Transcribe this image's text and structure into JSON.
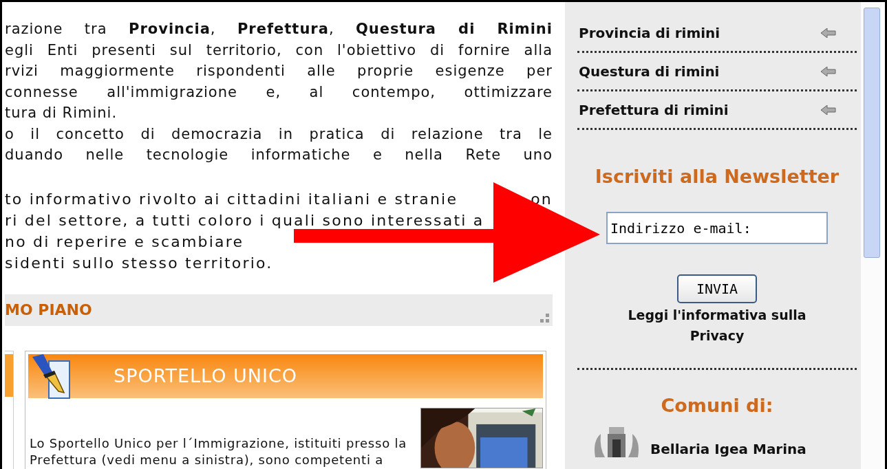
{
  "article": {
    "lines": [
      {
        "text": "razione tra **Provincia**, **Prefettura**, **Questura di Rimini**",
        "full": true
      },
      {
        "text": "egli Enti presenti sul territorio, con l'obiettivo di fornire alla",
        "full": true
      },
      {
        "text": "rvizi maggiormente rispondenti alle proprie esigenze per",
        "full": true
      },
      {
        "text": "connesse all'immigrazione e, al contempo, ottimizzare",
        "full": true
      },
      {
        "text": "tura di Rimini.",
        "full": false
      },
      {
        "text": "o il concetto di democrazia in pratica di relazione tra le",
        "full": true
      },
      {
        "text": "duando nelle tecnologie informatiche e nella Rete uno",
        "full": true
      }
    ],
    "lines_2": [
      {
        "text": "to informativo rivolto ai cittadini italiani e stranie",
        "tail": "on"
      },
      {
        "text": "ri del settore, a tutti coloro i quali sono interessati a"
      },
      {
        "text": "no di reperire e scambiare"
      },
      {
        "text": "sidenti sullo stesso territorio."
      }
    ]
  },
  "section": {
    "title": "MO PIANO"
  },
  "card": {
    "title": "SPORTELLO UNICO",
    "body": [
      "Lo Sportello Unico per l´Immigrazione, istituiti presso la",
      "Prefettura (vedi menu a sinistra), sono competenti a"
    ]
  },
  "sidebar": {
    "links": [
      {
        "label": "Provincia di rimini"
      },
      {
        "label": "Questura di rimini"
      },
      {
        "label": "Prefettura di rimini"
      }
    ],
    "newsletter": {
      "title": "Iscriviti alla Newsletter",
      "email": "Indirizzo e-mail:",
      "button": "INVIA",
      "privacy": "Leggi l'informativa sulla Privacy"
    },
    "comuni": {
      "title": "Comuni di:",
      "items": [
        "Bellaria Igea Marina"
      ]
    }
  }
}
